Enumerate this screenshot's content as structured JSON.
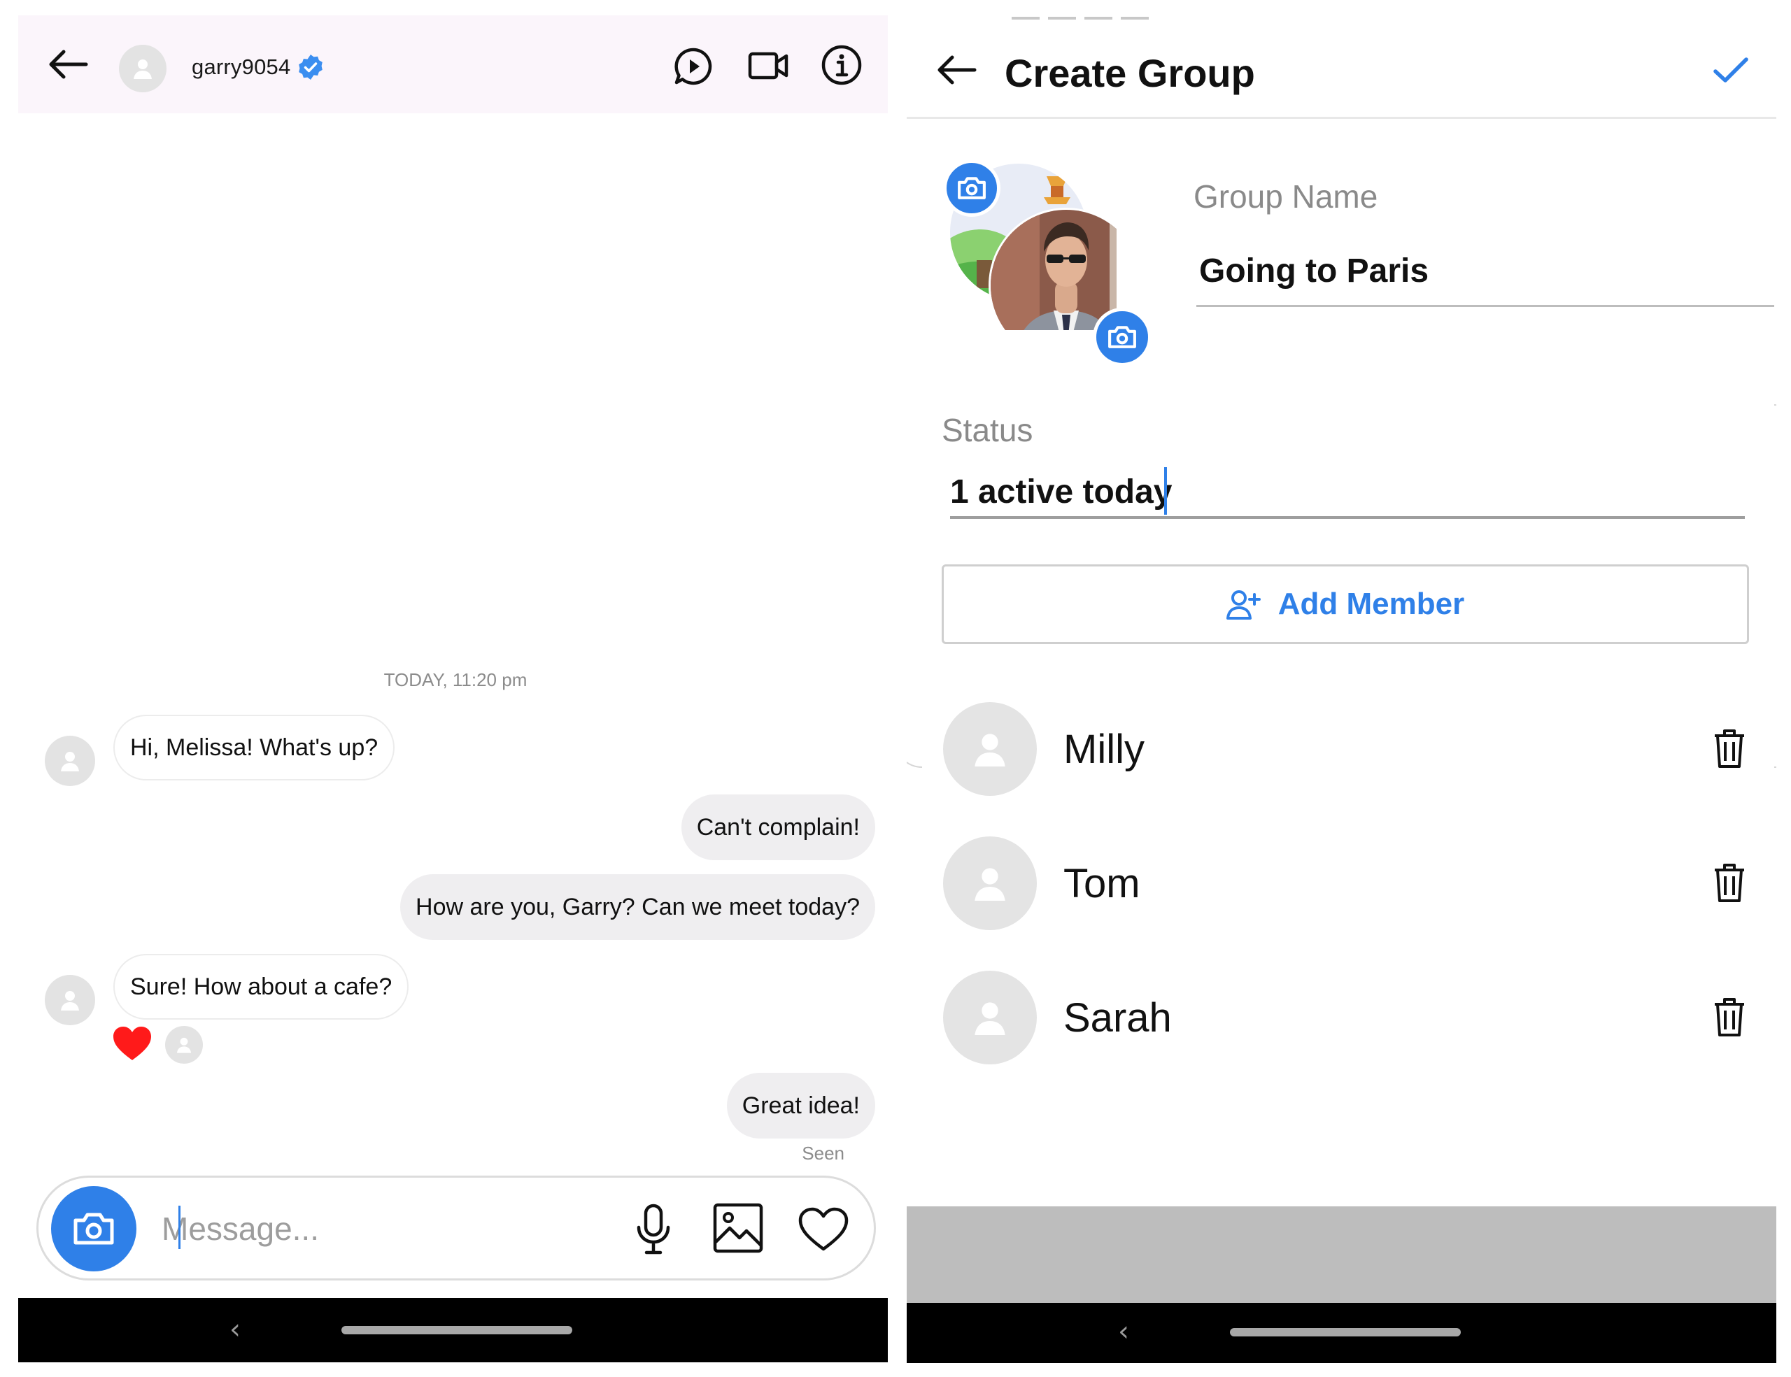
{
  "chat": {
    "username": "garry9054",
    "timestamp": "TODAY, 11:20 pm",
    "messages": [
      {
        "text": "Hi, Melissa! What's up?"
      },
      {
        "text": "Can't complain!"
      },
      {
        "text": "How are you, Garry? Can we meet today?"
      },
      {
        "text": "Sure! How about a cafe?"
      },
      {
        "text": "Great idea!"
      }
    ],
    "seen": "Seen",
    "message_placeholder": "Message...",
    "icons": {
      "back": "back-arrow-icon",
      "verified": "verified-badge-icon",
      "play": "play-circle-icon",
      "video": "video-call-icon",
      "info": "info-icon",
      "camera": "camera-icon",
      "mic": "microphone-icon",
      "gallery": "image-icon",
      "like": "heart-icon",
      "reaction": "heart-reaction-icon"
    },
    "colors": {
      "accent": "#2f80e8",
      "reaction": "#ff1a1a",
      "outgoing_bubble": "#efeef0"
    }
  },
  "create_group": {
    "title": "Create Group",
    "group_name_label": "Group Name",
    "group_name_value": "Going to Paris",
    "status_label": "Status",
    "status_value": "1 active today",
    "add_member_label": "Add Member",
    "members": [
      {
        "name": "Milly"
      },
      {
        "name": "Tom"
      },
      {
        "name": "Sarah"
      }
    ],
    "icons": {
      "back": "back-arrow-icon",
      "confirm": "checkmark-icon",
      "camera": "camera-icon",
      "add_member": "add-user-icon",
      "delete": "trash-icon",
      "avatar": "person-placeholder-icon"
    }
  },
  "system": {
    "nav_back": "‹"
  }
}
